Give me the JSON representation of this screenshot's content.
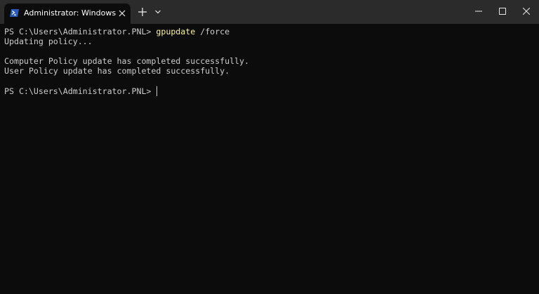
{
  "tab": {
    "title": "Administrator: Windows Powe",
    "icon": "powershell-icon"
  },
  "titlebar_buttons": {
    "new_tab": "plus-icon",
    "dropdown": "chevron-down-icon",
    "minimize": "minimize-icon",
    "maximize": "maximize-icon",
    "close": "close-icon"
  },
  "terminal": {
    "line1_prompt": "PS C:\\Users\\Administrator.PNL> ",
    "line1_command": "gpupdate",
    "line1_args": " /force",
    "line2": "Updating policy...",
    "line4": "Computer Policy update has completed successfully.",
    "line5": "User Policy update has completed successfully.",
    "line7_prompt": "PS C:\\Users\\Administrator.PNL> "
  },
  "colors": {
    "background": "#0c0c0c",
    "titlebar": "#2b2b2b",
    "text": "#cccccc",
    "command": "#f9f1a5",
    "powershell_icon": "#2a5bb8"
  }
}
